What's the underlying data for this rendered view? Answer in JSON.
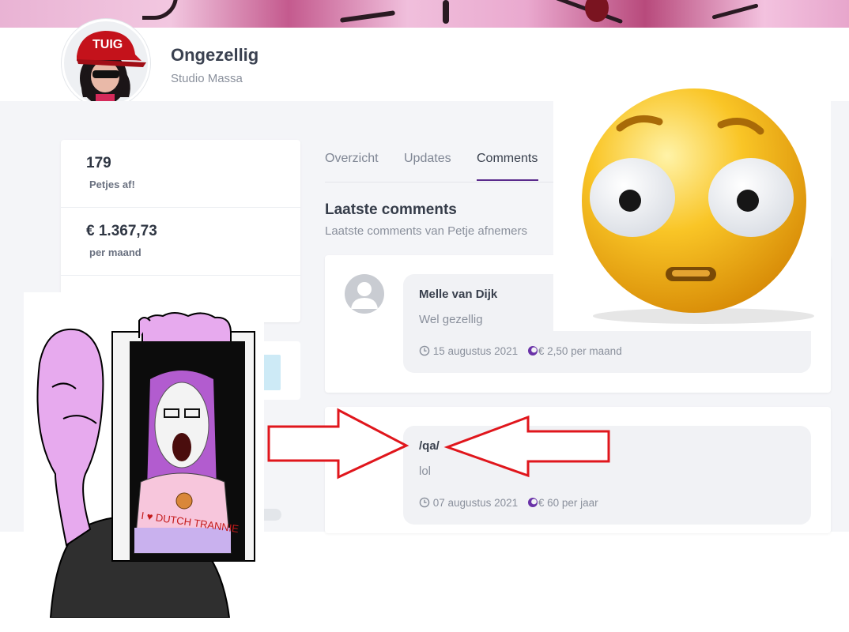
{
  "header": {
    "title": "Ongezellig",
    "subtitle": "Studio Massa",
    "avatar_cap_text": "TUIG"
  },
  "stats": [
    {
      "value": "179",
      "label": "Petjes af!"
    },
    {
      "value": "€ 1.367,73",
      "label": "per maand"
    }
  ],
  "tabs": [
    {
      "label": "Overzicht",
      "active": false
    },
    {
      "label": "Updates",
      "active": false
    },
    {
      "label": "Comments",
      "active": true
    }
  ],
  "section": {
    "title": "Laatste comments",
    "subtitle": "Laatste comments van Petje afnemers"
  },
  "comments": [
    {
      "author": "Melle van Dijk",
      "text": "Wel gezellig",
      "date": "15 augustus 2021",
      "amount": "€ 2,50 per maand"
    },
    {
      "author": "/qa/",
      "text": "lol",
      "date": "07 augustus 2021",
      "amount": "€ 60 per jaar"
    }
  ],
  "meme": {
    "shirt_text": "I ♥ DUTCH TRANNIE"
  },
  "colors": {
    "accent": "#5a2a8c",
    "background": "#f4f5f8",
    "arrow": "#e0161c"
  }
}
